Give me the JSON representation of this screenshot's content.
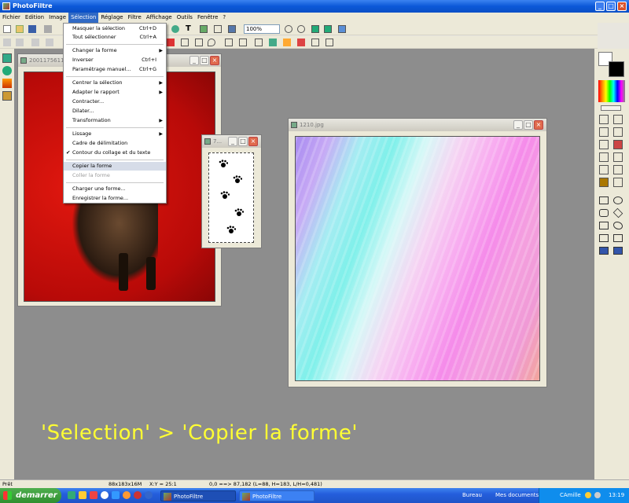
{
  "app": {
    "title": "PhotoFiltre"
  },
  "menubar": {
    "items": [
      "Fichier",
      "Edition",
      "Image",
      "Sélection",
      "Réglage",
      "Filtre",
      "Affichage",
      "Outils",
      "Fenêtre",
      "?"
    ]
  },
  "toolbar": {
    "zoom": "100%"
  },
  "windows": {
    "left_title": "2001175611",
    "stamp_title": "7...",
    "right_title": "1210.jpg"
  },
  "menu": {
    "items": [
      {
        "label": "Masquer la sélection",
        "shortcut": "Ctrl+D"
      },
      {
        "label": "Tout sélectionner",
        "shortcut": "Ctrl+A"
      },
      {
        "label": "Changer la forme",
        "submenu": true
      },
      {
        "label": "Inverser",
        "shortcut": "Ctrl+I"
      },
      {
        "label": "Paramétrage manuel...",
        "shortcut": "Ctrl+G"
      },
      {
        "label": "Centrer la sélection",
        "submenu": true
      },
      {
        "label": "Adapter le rapport",
        "submenu": true
      },
      {
        "label": "Contracter..."
      },
      {
        "label": "Dilater..."
      },
      {
        "label": "Transformation",
        "submenu": true
      },
      {
        "label": "Lissage",
        "submenu": true
      },
      {
        "label": "Cadre de délimitation"
      },
      {
        "label": "Contour du collage et du texte",
        "checked": true
      },
      {
        "label": "Copier la forme",
        "highlighted": true
      },
      {
        "label": "Coller la forme",
        "disabled": true
      },
      {
        "label": "Charger une forme..."
      },
      {
        "label": "Enregistrer la forme..."
      }
    ]
  },
  "status": {
    "state": "Prêt",
    "size": "88x183x16M",
    "coords": "X:Y = 25:1",
    "selection": "0,0 ==> 87,182 (L=88, H=183, L/H=0,481)"
  },
  "taskbar": {
    "start": "demarrer",
    "tasks": [
      "PhotoFiltre",
      "PhotoFiltre"
    ],
    "tray": [
      "Bureau",
      "Mes documents",
      "CAmille"
    ],
    "clock": "13:19"
  },
  "caption": "'Selection' > 'Copier la forme'",
  "colors": {
    "accent": "#316ac5",
    "caption": "#ffff33",
    "workspace": "#8d8d8d"
  }
}
